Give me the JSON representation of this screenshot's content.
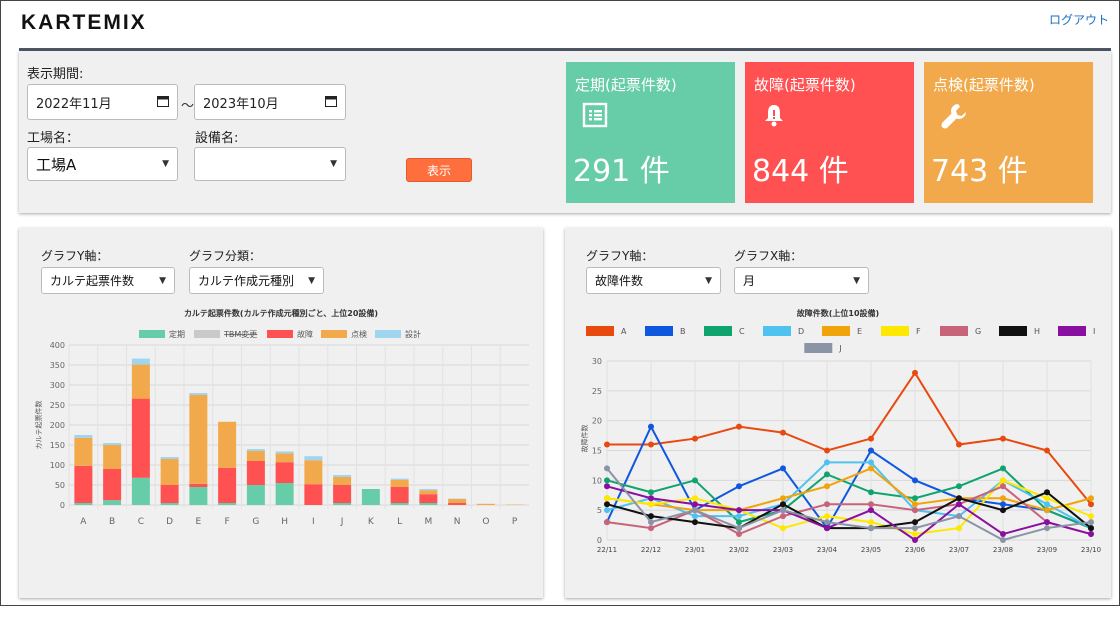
{
  "header": {
    "logo": "KARTEMIX",
    "logout": "ログアウト"
  },
  "filters": {
    "period_label": "表示期間:",
    "date_from": "2022年11月",
    "tilde": "～",
    "date_to": "2023年10月",
    "factory_label": "工場名：",
    "factory_value": "工場A",
    "equipment_label": "設備名:",
    "equipment_value": "",
    "show_button": "表示"
  },
  "cards": [
    {
      "title": "定期(起票件数)",
      "value": "291 件",
      "icon": "list-icon",
      "color": "#66cda8"
    },
    {
      "title": "故障(起票件数)",
      "value": "844 件",
      "icon": "bell-icon",
      "color": "#ff5052"
    },
    {
      "title": "点検(起票件数)",
      "value": "743 件",
      "icon": "wrench-icon",
      "color": "#f2a94b"
    }
  ],
  "left_panel": {
    "y_label": "グラフY軸：",
    "y_value": "カルテ起票件数",
    "cat_label": "グラフ分類：",
    "cat_value": "カルテ作成元種別"
  },
  "right_panel": {
    "y_label": "グラフY軸：",
    "y_value": "故障件数",
    "x_label": "グラフX軸：",
    "x_value": "月"
  },
  "chart_data": [
    {
      "type": "bar",
      "stacked": true,
      "title": "カルテ起票件数(カルテ作成元種別ごと、上位20設備)",
      "ylabel": "カルテ起票件数",
      "xlabel": "",
      "ylim": [
        0,
        400
      ],
      "yticks": [
        0,
        50,
        100,
        150,
        200,
        250,
        300,
        350,
        400
      ],
      "legend_position": "top",
      "categories": [
        "A",
        "B",
        "C",
        "D",
        "E",
        "F",
        "G",
        "H",
        "I",
        "J",
        "K",
        "L",
        "M",
        "N",
        "O",
        "P"
      ],
      "series": [
        {
          "name": "定期",
          "color": "#66cda8",
          "values": [
            5,
            12,
            68,
            5,
            45,
            5,
            50,
            55,
            0,
            5,
            40,
            5,
            5,
            0,
            0,
            0
          ]
        },
        {
          "name": "TBM変更",
          "color": "#c9c9c9",
          "hidden": true,
          "values": [
            0,
            0,
            0,
            0,
            0,
            0,
            0,
            0,
            0,
            0,
            0,
            0,
            0,
            0,
            0,
            0
          ]
        },
        {
          "name": "故障",
          "color": "#ff5052",
          "values": [
            93,
            78,
            198,
            45,
            8,
            88,
            60,
            52,
            52,
            45,
            0,
            40,
            22,
            5,
            0,
            0
          ]
        },
        {
          "name": "点検",
          "color": "#f2a94b",
          "values": [
            70,
            60,
            85,
            65,
            222,
            115,
            25,
            22,
            60,
            20,
            0,
            18,
            10,
            10,
            3,
            1
          ]
        },
        {
          "name": "設計",
          "color": "#9fd5ef",
          "values": [
            7,
            5,
            15,
            5,
            5,
            0,
            5,
            5,
            10,
            5,
            0,
            3,
            3,
            1,
            0,
            0
          ]
        }
      ]
    },
    {
      "type": "line",
      "title": "故障件数(上位10設備)",
      "ylabel": "故障件数",
      "xlabel": "",
      "ylim": [
        0,
        30
      ],
      "yticks": [
        0,
        5,
        10,
        15,
        20,
        25,
        30
      ],
      "legend_position": "top",
      "x": [
        "22/11",
        "22/12",
        "23/01",
        "23/02",
        "23/03",
        "23/04",
        "23/05",
        "23/06",
        "23/07",
        "23/08",
        "23/09",
        "23/10"
      ],
      "series": [
        {
          "name": "A",
          "color": "#e8490f",
          "values": [
            16,
            16,
            17,
            19,
            18,
            15,
            17,
            28,
            16,
            17,
            15,
            6
          ]
        },
        {
          "name": "B",
          "color": "#1057e0",
          "values": [
            3,
            19,
            5,
            9,
            12,
            2,
            15,
            10,
            7,
            6,
            5,
            2
          ]
        },
        {
          "name": "C",
          "color": "#0fa46e",
          "values": [
            10,
            8,
            10,
            3,
            5,
            11,
            8,
            7,
            9,
            12,
            5,
            2
          ]
        },
        {
          "name": "D",
          "color": "#4fc2f0",
          "values": [
            5,
            7,
            4,
            4,
            6,
            13,
            13,
            5,
            4,
            10,
            6,
            2
          ]
        },
        {
          "name": "E",
          "color": "#f0a30a",
          "values": [
            7,
            6,
            5,
            5,
            7,
            9,
            12,
            6,
            7,
            7,
            5,
            7
          ]
        },
        {
          "name": "F",
          "color": "#ffe800",
          "values": [
            7,
            6,
            7,
            5,
            2,
            4,
            3,
            1,
            2,
            10,
            7,
            4
          ]
        },
        {
          "name": "G",
          "color": "#c7647a",
          "values": [
            3,
            2,
            5,
            1,
            4,
            6,
            6,
            5,
            6,
            9,
            3,
            1
          ]
        },
        {
          "name": "H",
          "color": "#111111",
          "values": [
            6,
            4,
            3,
            2,
            6,
            2,
            2,
            3,
            7,
            5,
            8,
            2
          ]
        },
        {
          "name": "I",
          "color": "#8a0fa0",
          "values": [
            9,
            7,
            6,
            5,
            5,
            2,
            5,
            0,
            6,
            1,
            3,
            1
          ]
        },
        {
          "name": "J",
          "color": "#8a94a6",
          "values": [
            12,
            3,
            5,
            2,
            5,
            3,
            2,
            2,
            4,
            0,
            2,
            3
          ]
        }
      ]
    }
  ]
}
